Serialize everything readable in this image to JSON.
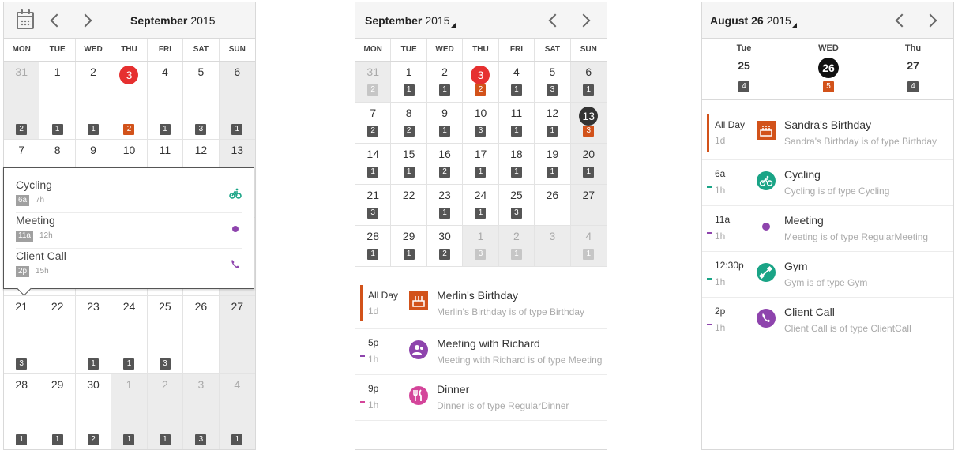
{
  "colors": {
    "accent_red": "#e63030",
    "badge_dark": "#555555",
    "badge_orange": "#d2521a",
    "birthday": "#d2521a",
    "cycling": "#1aa486",
    "meeting": "#8e44ad",
    "dinner": "#d4459a",
    "gym": "#1aa486",
    "call": "#8e44ad"
  },
  "p1": {
    "month": "September",
    "year": "2015",
    "dow": [
      "MON",
      "TUE",
      "WED",
      "THU",
      "FRI",
      "SAT",
      "SUN"
    ],
    "weeks": [
      [
        {
          "n": "31",
          "out": true,
          "b": "2"
        },
        {
          "n": "1",
          "b": "1"
        },
        {
          "n": "2",
          "b": "1"
        },
        {
          "n": "3",
          "today": true,
          "b": "2",
          "bo": true
        },
        {
          "n": "4",
          "b": "1"
        },
        {
          "n": "5",
          "b": "3"
        },
        {
          "n": "6",
          "b": "1",
          "we": true
        }
      ],
      [
        {
          "n": "7"
        },
        {
          "n": "8"
        },
        {
          "n": "9"
        },
        {
          "n": "10"
        },
        {
          "n": "11"
        },
        {
          "n": "12"
        },
        {
          "n": "13",
          "we": true
        }
      ],
      [
        {
          "n": ""
        },
        {
          "n": ""
        },
        {
          "n": ""
        },
        {
          "n": ""
        },
        {
          "n": ""
        },
        {
          "n": ""
        },
        {
          "n": "",
          "we": true
        }
      ],
      [
        {
          "n": "21",
          "b": "3"
        },
        {
          "n": "22"
        },
        {
          "n": "23",
          "b": "1"
        },
        {
          "n": "24",
          "b": "1"
        },
        {
          "n": "25",
          "b": "3"
        },
        {
          "n": "26"
        },
        {
          "n": "27",
          "we": true
        }
      ],
      [
        {
          "n": "28",
          "b": "1"
        },
        {
          "n": "29",
          "b": "1"
        },
        {
          "n": "30",
          "b": "2"
        },
        {
          "n": "1",
          "out": true,
          "b": "1"
        },
        {
          "n": "2",
          "out": true,
          "b": "1"
        },
        {
          "n": "3",
          "out": true,
          "b": "3"
        },
        {
          "n": "4",
          "out": true,
          "b": "1"
        }
      ]
    ],
    "popup": [
      {
        "title": "Cycling",
        "time": "6a",
        "duration": "7h",
        "icon": "bicycle-icon"
      },
      {
        "title": "Meeting",
        "time": "11a",
        "duration": "12h",
        "icon": "dot-icon"
      },
      {
        "title": "Client Call",
        "time": "2p",
        "duration": "15h",
        "icon": "phone-icon"
      }
    ]
  },
  "p2": {
    "month": "September",
    "year": "2015",
    "dow": [
      "MON",
      "TUE",
      "WED",
      "THU",
      "FRI",
      "SAT",
      "SUN"
    ],
    "weeks": [
      [
        {
          "n": "31",
          "out": true,
          "b": "2",
          "bf": true
        },
        {
          "n": "1",
          "b": "1"
        },
        {
          "n": "2",
          "b": "1"
        },
        {
          "n": "3",
          "today": true,
          "b": "2",
          "bo": true
        },
        {
          "n": "4",
          "b": "1"
        },
        {
          "n": "5",
          "b": "3"
        },
        {
          "n": "6",
          "b": "1",
          "we": true
        }
      ],
      [
        {
          "n": "7",
          "b": "2"
        },
        {
          "n": "8",
          "b": "2"
        },
        {
          "n": "9",
          "b": "1"
        },
        {
          "n": "10",
          "b": "3"
        },
        {
          "n": "11",
          "b": "1"
        },
        {
          "n": "12",
          "b": "1"
        },
        {
          "n": "13",
          "sel": true,
          "b": "3",
          "bo": true,
          "we": true
        }
      ],
      [
        {
          "n": "14",
          "b": "1"
        },
        {
          "n": "15",
          "b": "1"
        },
        {
          "n": "16",
          "b": "2"
        },
        {
          "n": "17",
          "b": "1"
        },
        {
          "n": "18",
          "b": "1"
        },
        {
          "n": "19",
          "b": "1"
        },
        {
          "n": "20",
          "b": "1",
          "we": true
        }
      ],
      [
        {
          "n": "21",
          "b": "3"
        },
        {
          "n": "22"
        },
        {
          "n": "23",
          "b": "1"
        },
        {
          "n": "24",
          "b": "1"
        },
        {
          "n": "25",
          "b": "3"
        },
        {
          "n": "26"
        },
        {
          "n": "27",
          "we": true
        }
      ],
      [
        {
          "n": "28",
          "b": "1"
        },
        {
          "n": "29",
          "b": "1"
        },
        {
          "n": "30",
          "b": "2"
        },
        {
          "n": "1",
          "out": true,
          "b": "3",
          "bf": true
        },
        {
          "n": "2",
          "out": true,
          "b": "1",
          "bf": true
        },
        {
          "n": "3",
          "out": true
        },
        {
          "n": "4",
          "out": true,
          "b": "1",
          "bf": true
        }
      ]
    ],
    "agenda": [
      {
        "time": "All Day",
        "duration": "1d",
        "title": "Merlin's Birthday",
        "subtitle": "Merlin's Birthday is of type Birthday",
        "icon": "cake-icon",
        "color": "#d2521a",
        "allday": true
      },
      {
        "time": "5p",
        "duration": "1h",
        "title": "Meeting with Richard",
        "subtitle": "Meeting with Richard is of type Meeting",
        "icon": "people-icon",
        "color": "#8e44ad"
      },
      {
        "time": "9p",
        "duration": "1h",
        "title": "Dinner",
        "subtitle": "Dinner is of type RegularDinner",
        "icon": "cutlery-icon",
        "color": "#d4459a"
      }
    ]
  },
  "p3": {
    "title": "August 26",
    "year": "2015",
    "days": [
      {
        "dow": "Tue",
        "num": "25",
        "badge": "4"
      },
      {
        "dow": "WED",
        "num": "26",
        "badge": "5",
        "selected": true
      },
      {
        "dow": "Thu",
        "num": "27",
        "badge": "4"
      }
    ],
    "agenda": [
      {
        "time": "All Day",
        "duration": "1d",
        "title": "Sandra's Birthday",
        "subtitle": "Sandra's Birthday is of type Birthday",
        "icon": "cake-icon",
        "color": "#d2521a",
        "allday": true
      },
      {
        "time": "6a",
        "duration": "1h",
        "title": "Cycling",
        "subtitle": "Cycling is of type Cycling",
        "icon": "bicycle-icon",
        "color": "#1aa486"
      },
      {
        "time": "11a",
        "duration": "1h",
        "title": "Meeting",
        "subtitle": "Meeting is of type RegularMeeting",
        "icon": "dot-icon",
        "color": "#8e44ad"
      },
      {
        "time": "12:30p",
        "duration": "1h",
        "title": "Gym",
        "subtitle": "Gym is of type Gym",
        "icon": "dumbbell-icon",
        "color": "#1aa486"
      },
      {
        "time": "2p",
        "duration": "1h",
        "title": "Client Call",
        "subtitle": "Client Call is of type ClientCall",
        "icon": "phone-icon",
        "color": "#8e44ad"
      }
    ]
  }
}
